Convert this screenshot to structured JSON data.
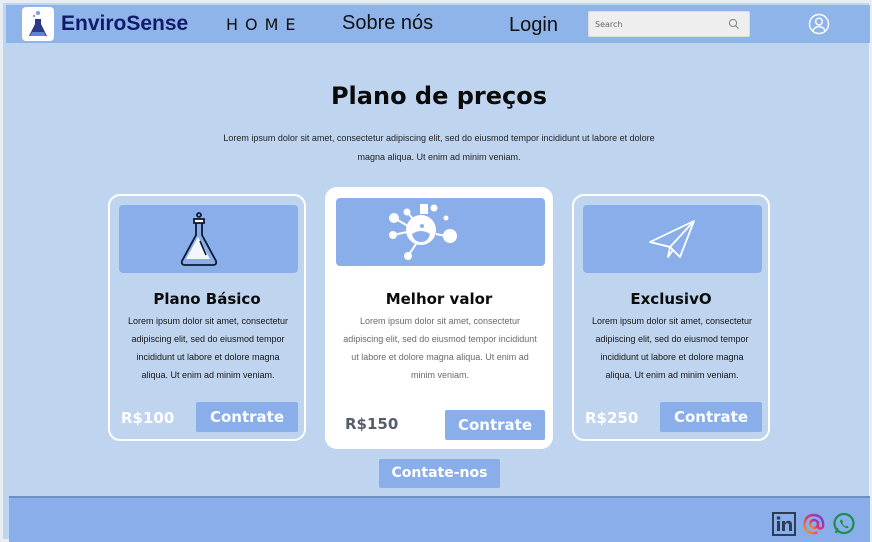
{
  "header": {
    "brand": "EnviroSense",
    "nav": {
      "home": "HOME",
      "about": "Sobre nós",
      "login": "Login"
    },
    "search": {
      "placeholder": "Search"
    }
  },
  "main": {
    "title": "Plano de preços",
    "subtitle": "Lorem ipsum dolor sit amet, consectetur adipiscing elit, sed do eiusmod tempor incididunt ut labore et dolore magna aliqua. Ut enim ad minim veniam.",
    "plans": [
      {
        "name": "Plano Básico",
        "icon": "flask-icon",
        "description": "Lorem ipsum dolor sit amet, consectetur adipiscing elit, sed do eiusmod tempor incididunt ut labore et dolore magna aliqua. Ut enim ad minim veniam.",
        "price": "R$100",
        "cta": "Contrate"
      },
      {
        "name": "Melhor valor",
        "icon": "science-molecule-icon",
        "description": "Lorem ipsum dolor sit amet, consectetur adipiscing elit, sed do eiusmod tempor incididunt ut labore et dolore magna aliqua. Ut enim ad minim veniam.",
        "price": "R$150",
        "cta": "Contrate"
      },
      {
        "name": "ExclusivO",
        "icon": "paper-plane-icon",
        "description": "Lorem ipsum dolor sit amet, consectetur adipiscing elit, sed do eiusmod tempor incididunt ut labore et dolore magna aliqua. Ut enim ad minim veniam.",
        "price": "R$250",
        "cta": "Contrate"
      }
    ],
    "contact_button": "Contate-nos"
  },
  "footer": {
    "social": [
      "linkedin-icon",
      "threads-icon",
      "whatsapp-icon"
    ]
  },
  "colors": {
    "page_bg": "#bed4ef",
    "nav_bg": "#8fb4ea",
    "accent": "#89aeea",
    "brand_text": "#101c6a"
  }
}
